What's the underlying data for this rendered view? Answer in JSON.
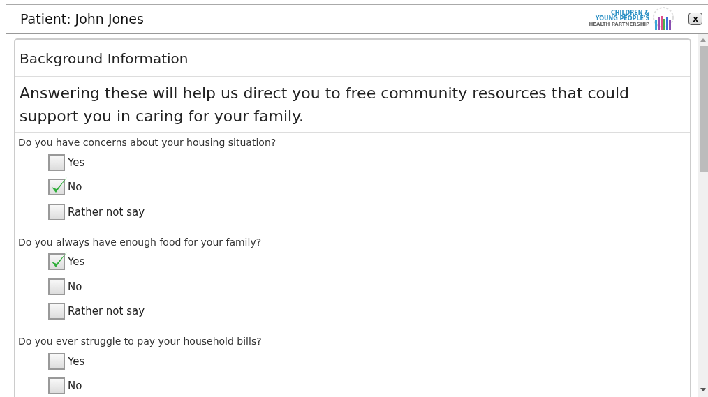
{
  "window": {
    "title": "Patient: John Jones",
    "logo_lines": [
      "CHILDREN &",
      "YOUNG PEOPLE'S",
      "HEALTH PARTNERSHIP"
    ],
    "close_label": "x"
  },
  "card": {
    "title": "Background Information",
    "intro": "Answering these will help us direct you to free community resources that could support you in caring for your family."
  },
  "questions": [
    {
      "text": "Do you have concerns about your housing situation?",
      "options": [
        {
          "label": "Yes",
          "checked": false
        },
        {
          "label": "No",
          "checked": true
        },
        {
          "label": "Rather not say",
          "checked": false
        }
      ]
    },
    {
      "text": "Do you always have enough food for your family?",
      "options": [
        {
          "label": "Yes",
          "checked": true
        },
        {
          "label": "No",
          "checked": false
        },
        {
          "label": "Rather not say",
          "checked": false
        }
      ]
    },
    {
      "text": "Do you ever struggle to pay your household bills?",
      "options": [
        {
          "label": "Yes",
          "checked": false
        },
        {
          "label": "No",
          "checked": false
        }
      ]
    }
  ]
}
